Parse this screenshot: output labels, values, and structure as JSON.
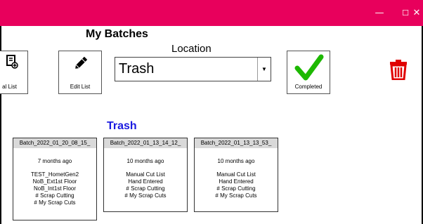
{
  "window": {
    "minimize_glyph": "—",
    "maximize_glyph": "☐",
    "close_glyph": "✕"
  },
  "header": {
    "title": "My Batches"
  },
  "location": {
    "label": "Location",
    "selected": "Trash"
  },
  "toolbar": {
    "list_label": "al List",
    "edit_label": "Edit List",
    "completed_label": "Completed"
  },
  "section": {
    "title": "Trash"
  },
  "batches": [
    {
      "name": "Batch_2022_01_20_08_15_",
      "age": "7 months ago",
      "lines": [
        "TEST_HometGen2",
        "NoB_Ext1st Floor",
        "NoB_Int1st Floor",
        "# Scrap Cutting",
        "# My Scrap Cuts"
      ]
    },
    {
      "name": "Batch_2022_01_13_14_12_",
      "age": "10 months ago",
      "lines": [
        "Manual Cut List",
        "Hand Entered",
        "# Scrap Cutting",
        "# My Scrap Cuts"
      ]
    },
    {
      "name": "Batch_2022_01_13_13_53_",
      "age": "10 months ago",
      "lines": [
        "Manual Cut List",
        "Hand Entered",
        "# Scrap Cutting",
        "# My Scrap Cuts"
      ]
    }
  ],
  "colors": {
    "titlebar": "#e8005c",
    "section_title": "#1a1ae0",
    "check": "#1db800",
    "trash": "#e00000"
  }
}
